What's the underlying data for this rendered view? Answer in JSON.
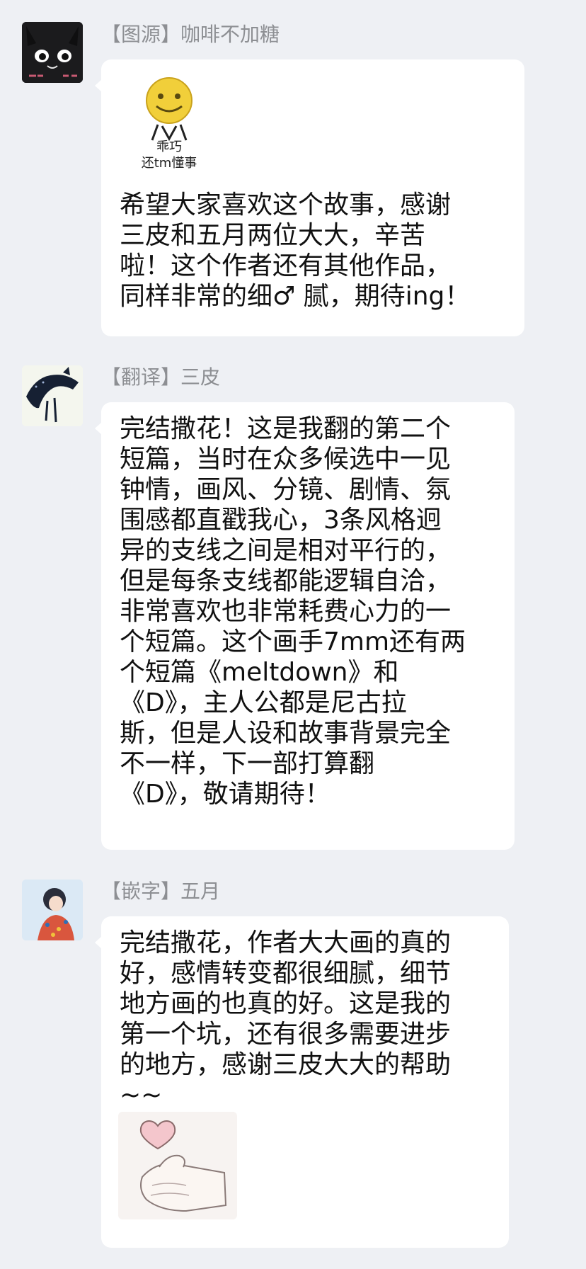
{
  "messages": [
    {
      "sender": "【图源】咖啡不加糖",
      "avatar_icon": "black-cat-avatar",
      "sticker": {
        "icon": "smiley-face-sticker",
        "caption_line1": "乖巧",
        "caption_line2": "还tm懂事"
      },
      "text": "希望大家喜欢这个故事，感谢\n三皮和五月两位大大，辛苦\n啦！这个作者还有其他作品，\n同样非常的细♂ 腻，期待ing！"
    },
    {
      "sender": "【翻译】三皮",
      "avatar_icon": "dark-cat-silhouette-avatar",
      "text": "完结撒花！这是我翻的第二个\n短篇，当时在众多候选中一见\n钟情，画风、分镜、剧情、氛\n围感都直戳我心，3条风格迥\n异的支线之间是相对平行的，\n但是每条支线都能逻辑自洽，\n非常喜欢也非常耗费心力的一\n个短篇。这个画手7mm还有两\n个短篇《meltdown》和\n《D》，主人公都是尼古拉\n斯，但是人设和故事背景完全\n不一样，下一部打算翻\n《D》，敬请期待！"
    },
    {
      "sender": "【嵌字】五月",
      "avatar_icon": "anime-girl-avatar",
      "text": "完结撒花，作者大大画的真的\n好，感情转变都很细腻，细节\n地方画的也真的好。这是我的\n第一个坑，还有很多需要进步\n的地方，感谢三皮大大的帮助\n~~",
      "sticker": {
        "icon": "finger-heart-sticker"
      }
    }
  ],
  "colors": {
    "background": "#eef0f4",
    "bubble": "#ffffff",
    "sender_text": "#8d8f93",
    "message_text": "#111111"
  }
}
